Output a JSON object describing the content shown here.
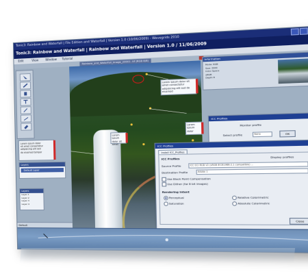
{
  "window": {
    "title_small": "Tonic3: Rainbow and Waterfall | File Edition and Waterfall | Version 1.0 (10/06/2009) - Wavegrids 2010",
    "title_large": "Tonic3: Rainbow and Waterfall | Rainbow and Waterfall | Version 1.0 / 11/06/2009"
  },
  "menu": [
    "Edit",
    "View",
    "Window",
    "Tutorial"
  ],
  "image_tab": "Rainbow_and_Waterfall_Image_20001 .tif (RGB 8/8)",
  "annotations": {
    "a1": "Lorem ipsum dolor sit amet consectetur adipisicing elit sed do eiusmod",
    "a2": "Lorem ipsum dolor sit amet",
    "a3": "Lorem ipsum dolor",
    "a4": "Lorem ipsum dolor sit",
    "a5": "Lorem ipsum dolor sit amet consectetur"
  },
  "left_panels": {
    "p1_lines": [
      "Lorem ipsum dolor",
      "sit amet consectetur",
      "adipisicing elit sed",
      "do eiusmod tempor"
    ],
    "p2_title": "Layers",
    "p2_item": "Default Layer",
    "p3_title": "Layers",
    "p3_items": [
      "Layer 1",
      "Layer 2",
      "Layer 3",
      "Layer 4"
    ],
    "status": "Default"
  },
  "navigator": {
    "title": "Information",
    "lines": [
      "Mode: RGB",
      "Size: 2000",
      "Color Space",
      "sRGB",
      "Depth 8"
    ]
  },
  "icc_small": {
    "title": "ICC Profiles",
    "label_monitor": "Monitor profile",
    "label_select": "Select profile",
    "select_value": "None",
    "ok": "OK"
  },
  "icc_main": {
    "title": "ICC Profiles",
    "tab": "Install ICC_Profiles",
    "header": "ICC Profiles",
    "view_link": "Display profiles",
    "source_label": "Source Profile",
    "source_value": "ICC ECI RGB V2 (sRGB IEC61966-2.1 compatible) ...",
    "dest_label": "Destination Profile",
    "dest_value": "Adobe 1",
    "bp_label": "Use Black Point Compensation",
    "dither_label": "Use Dither (for 8 bit images)",
    "intent_header": "Rendering Intent",
    "intents": [
      "Perceptual",
      "Saturation",
      "Relative Colorimetric",
      "Absolute Colorimetric"
    ],
    "close": "Close"
  },
  "colors": {
    "titlebar": "#1b2e78",
    "panel_blue": "#34508f",
    "marker_red": "#d11a1a",
    "close_red": "#c2382b"
  }
}
